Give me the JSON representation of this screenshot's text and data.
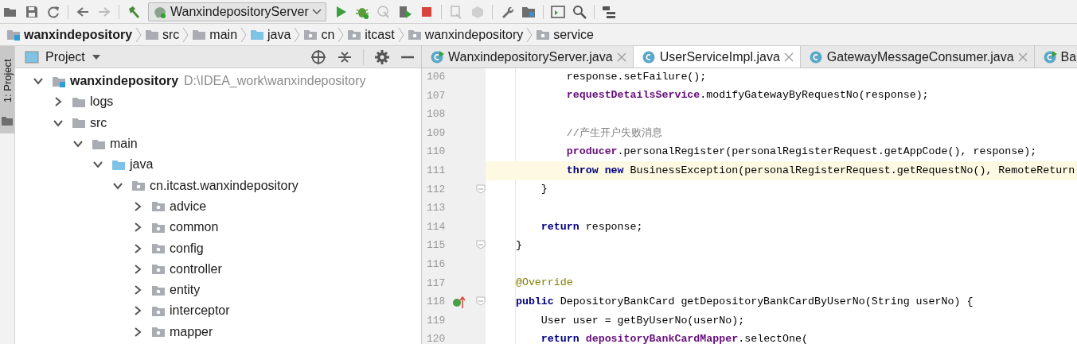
{
  "toolbar": {
    "run_config": "WanxindepositoryServer"
  },
  "breadcrumbs": [
    {
      "label": "wanxindepository",
      "kind": "module"
    },
    {
      "label": "src",
      "kind": "folder"
    },
    {
      "label": "main",
      "kind": "folder"
    },
    {
      "label": "java",
      "kind": "source"
    },
    {
      "label": "cn",
      "kind": "package"
    },
    {
      "label": "itcast",
      "kind": "package"
    },
    {
      "label": "wanxindepository",
      "kind": "package"
    },
    {
      "label": "service",
      "kind": "package"
    }
  ],
  "side_tab": "1: Project",
  "project_panel": {
    "title": "Project",
    "tree": [
      {
        "label": "wanxindepository",
        "path": "D:\\IDEA_work\\wanxindepository",
        "kind": "module",
        "expanded": true,
        "children": [
          {
            "label": "logs",
            "kind": "folder",
            "expanded": false
          },
          {
            "label": "src",
            "kind": "folder",
            "expanded": true,
            "children": [
              {
                "label": "main",
                "kind": "folder",
                "expanded": true,
                "children": [
                  {
                    "label": "java",
                    "kind": "source",
                    "expanded": true,
                    "children": [
                      {
                        "label": "cn.itcast.wanxindepository",
                        "kind": "package",
                        "expanded": true,
                        "children": [
                          {
                            "label": "advice",
                            "kind": "package",
                            "expanded": false
                          },
                          {
                            "label": "common",
                            "kind": "package",
                            "expanded": false
                          },
                          {
                            "label": "config",
                            "kind": "package",
                            "expanded": false
                          },
                          {
                            "label": "controller",
                            "kind": "package",
                            "expanded": false
                          },
                          {
                            "label": "entity",
                            "kind": "package",
                            "expanded": false
                          },
                          {
                            "label": "interceptor",
                            "kind": "package",
                            "expanded": false
                          },
                          {
                            "label": "mapper",
                            "kind": "package",
                            "expanded": false
                          }
                        ]
                      }
                    ]
                  }
                ]
              }
            ]
          }
        ]
      }
    ]
  },
  "editor": {
    "tabs": [
      {
        "label": "WanxindepositoryServer.java",
        "kind": "runnable",
        "selected": false
      },
      {
        "label": "UserServiceImpl.java",
        "kind": "class",
        "selected": true
      },
      {
        "label": "GatewayMessageConsumer.java",
        "kind": "class",
        "selected": false
      },
      {
        "label": "Ba",
        "kind": "runnable",
        "selected": false
      }
    ],
    "lines": [
      {
        "number": "106",
        "highlighted": false,
        "segments": [
          {
            "kind": "plain",
            "text": "            response.setFailure();"
          }
        ]
      },
      {
        "number": "107",
        "highlighted": false,
        "segments": [
          {
            "kind": "field",
            "text": "            requestDetailsService"
          },
          {
            "kind": "plain",
            "text": ".modifyGatewayByRequestNo(response);"
          }
        ]
      },
      {
        "number": "108",
        "highlighted": false
      },
      {
        "number": "109",
        "highlighted": false,
        "segments": [
          {
            "kind": "comment",
            "text": "            //产生开户失败消息"
          }
        ]
      },
      {
        "number": "110",
        "highlighted": false,
        "segments": [
          {
            "kind": "field",
            "text": "            producer"
          },
          {
            "kind": "plain",
            "text": ".personalRegister(personalRegisterRequest.getAppCode(), response);"
          }
        ]
      },
      {
        "number": "111",
        "highlighted": true,
        "segments": [
          {
            "kind": "keyword",
            "text": "            throw new"
          },
          {
            "kind": "plain",
            "text": " BusinessException(personalRegisterRequest.getRequestNo(), RemoteReturn"
          }
        ]
      },
      {
        "number": "112",
        "highlighted": false,
        "fold": true,
        "segments": [
          {
            "kind": "plain",
            "text": "        }"
          }
        ]
      },
      {
        "number": "113",
        "highlighted": false
      },
      {
        "number": "114",
        "highlighted": false,
        "segments": [
          {
            "kind": "keyword",
            "text": "        return"
          },
          {
            "kind": "plain",
            "text": " response;"
          }
        ]
      },
      {
        "number": "115",
        "highlighted": false,
        "fold": true,
        "segments": [
          {
            "kind": "plain",
            "text": "    }"
          }
        ]
      },
      {
        "number": "116",
        "highlighted": false
      },
      {
        "number": "117",
        "highlighted": false,
        "segments": [
          {
            "kind": "annotation",
            "text": "    @Override"
          }
        ]
      },
      {
        "number": "118",
        "highlighted": false,
        "fold": true,
        "implements": true,
        "segments": [
          {
            "kind": "keyword",
            "text": "    public"
          },
          {
            "kind": "plain",
            "text": " DepositoryBankCard getDepositoryBankCardByUserNo(String userNo) {"
          }
        ]
      },
      {
        "number": "119",
        "highlighted": false,
        "segments": [
          {
            "kind": "plain",
            "text": "        User user = getByUserNo(userNo);"
          }
        ]
      },
      {
        "number": "120",
        "highlighted": false,
        "segments": [
          {
            "kind": "keyword",
            "text": "        return"
          },
          {
            "kind": "field",
            "text": " depositoryBankCardMapper"
          },
          {
            "kind": "plain",
            "text": ".selectOne("
          }
        ]
      }
    ]
  }
}
